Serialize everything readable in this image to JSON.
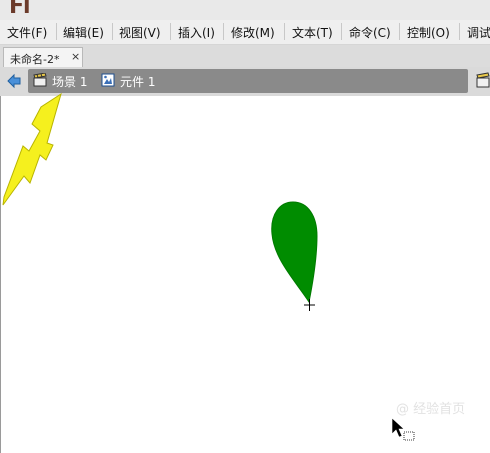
{
  "app": {
    "logo": "Fl"
  },
  "menubar": {
    "items": [
      {
        "label": "文件(F)"
      },
      {
        "label": "编辑(E)"
      },
      {
        "label": "视图(V)"
      },
      {
        "label": "插入(I)"
      },
      {
        "label": "修改(M)"
      },
      {
        "label": "文本(T)"
      },
      {
        "label": "命令(C)"
      },
      {
        "label": "控制(O)"
      },
      {
        "label": "调试"
      }
    ]
  },
  "document_tab": {
    "label": "未命名-2*",
    "close": "×"
  },
  "breadcrumb": {
    "scene_label": "场景 1",
    "symbol_label": "元件 1"
  },
  "stage": {
    "shape_color": "#008c00",
    "arrow_color": "#f5f01e"
  },
  "watermark": {
    "text": "@ 经验首页"
  },
  "colors": {
    "menubar_bg": "#efefef",
    "navbar_bg": "#dadada",
    "breadcrumb_bg": "#8a8a8a"
  }
}
